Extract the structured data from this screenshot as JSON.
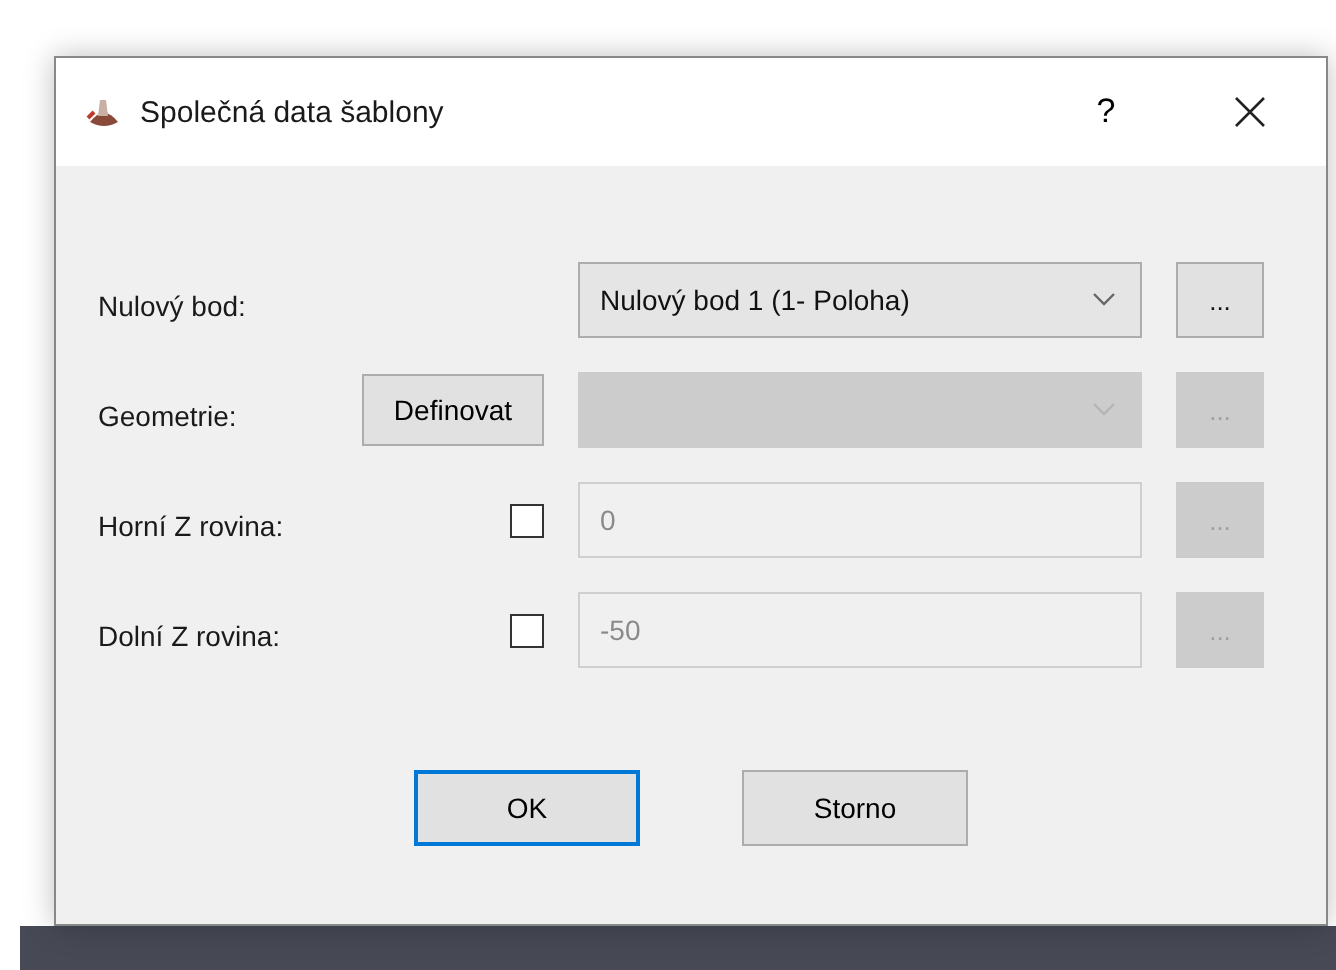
{
  "window": {
    "title": "Společná data šablony",
    "help": "?"
  },
  "rows": [
    {
      "kind": "dropdown",
      "label": "Nulový bod:",
      "value": "Nulový bod 1 (1- Poloha)",
      "disabled": false,
      "browse": "..."
    },
    {
      "kind": "define-dropdown",
      "label": "Geometrie:",
      "action": "Definovat",
      "disabled": true,
      "browse": "..."
    },
    {
      "kind": "checkbox-field",
      "label": "Horní Z rovina:",
      "checked": false,
      "value": "0",
      "disabled": true,
      "browse": "..."
    },
    {
      "kind": "checkbox-field",
      "label": "Dolní Z rovina:",
      "checked": false,
      "value": "-50",
      "disabled": true,
      "browse": "..."
    }
  ],
  "buttons": [
    {
      "label": "OK",
      "default": true
    },
    {
      "label": "Storno",
      "default": false
    }
  ]
}
